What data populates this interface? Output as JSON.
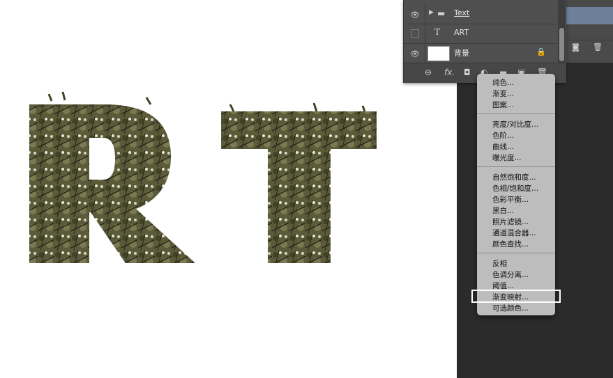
{
  "layers": [
    {
      "name": "Text",
      "type": "group",
      "visible": true
    },
    {
      "name": "ART",
      "type": "text",
      "visible": false
    },
    {
      "name": "背景",
      "type": "background",
      "visible": true,
      "locked": true
    }
  ],
  "canvas": {
    "letters": [
      "R",
      "T"
    ]
  },
  "adjustment_menu": {
    "groups": [
      [
        "纯色...",
        "渐变...",
        "图案..."
      ],
      [
        "亮度/对比度...",
        "色阶...",
        "曲线...",
        "曝光度..."
      ],
      [
        "自然饱和度...",
        "色相/饱和度...",
        "色彩平衡...",
        "黑白...",
        "照片滤镜...",
        "通道混合器...",
        "颜色查找..."
      ],
      [
        "反相",
        "色调分离...",
        "阈值...",
        "渐变映射...",
        "可选颜色..."
      ]
    ],
    "highlighted": "渐变映射..."
  },
  "icons": {
    "layer_visibility": "eye-icon",
    "group": "folder-icon",
    "text_layer": "text-t-icon",
    "lock": "lock-icon",
    "bottom_bar": [
      "link-icon",
      "fx-icon",
      "mask-icon",
      "adjustment-icon",
      "folder-icon",
      "new-layer-icon",
      "trash-icon"
    ]
  },
  "colors": {
    "workspace": "#2b2b2b",
    "panel": "#4f4f4f",
    "menu": "#bdbdbd",
    "selected": "#6e7f99"
  }
}
